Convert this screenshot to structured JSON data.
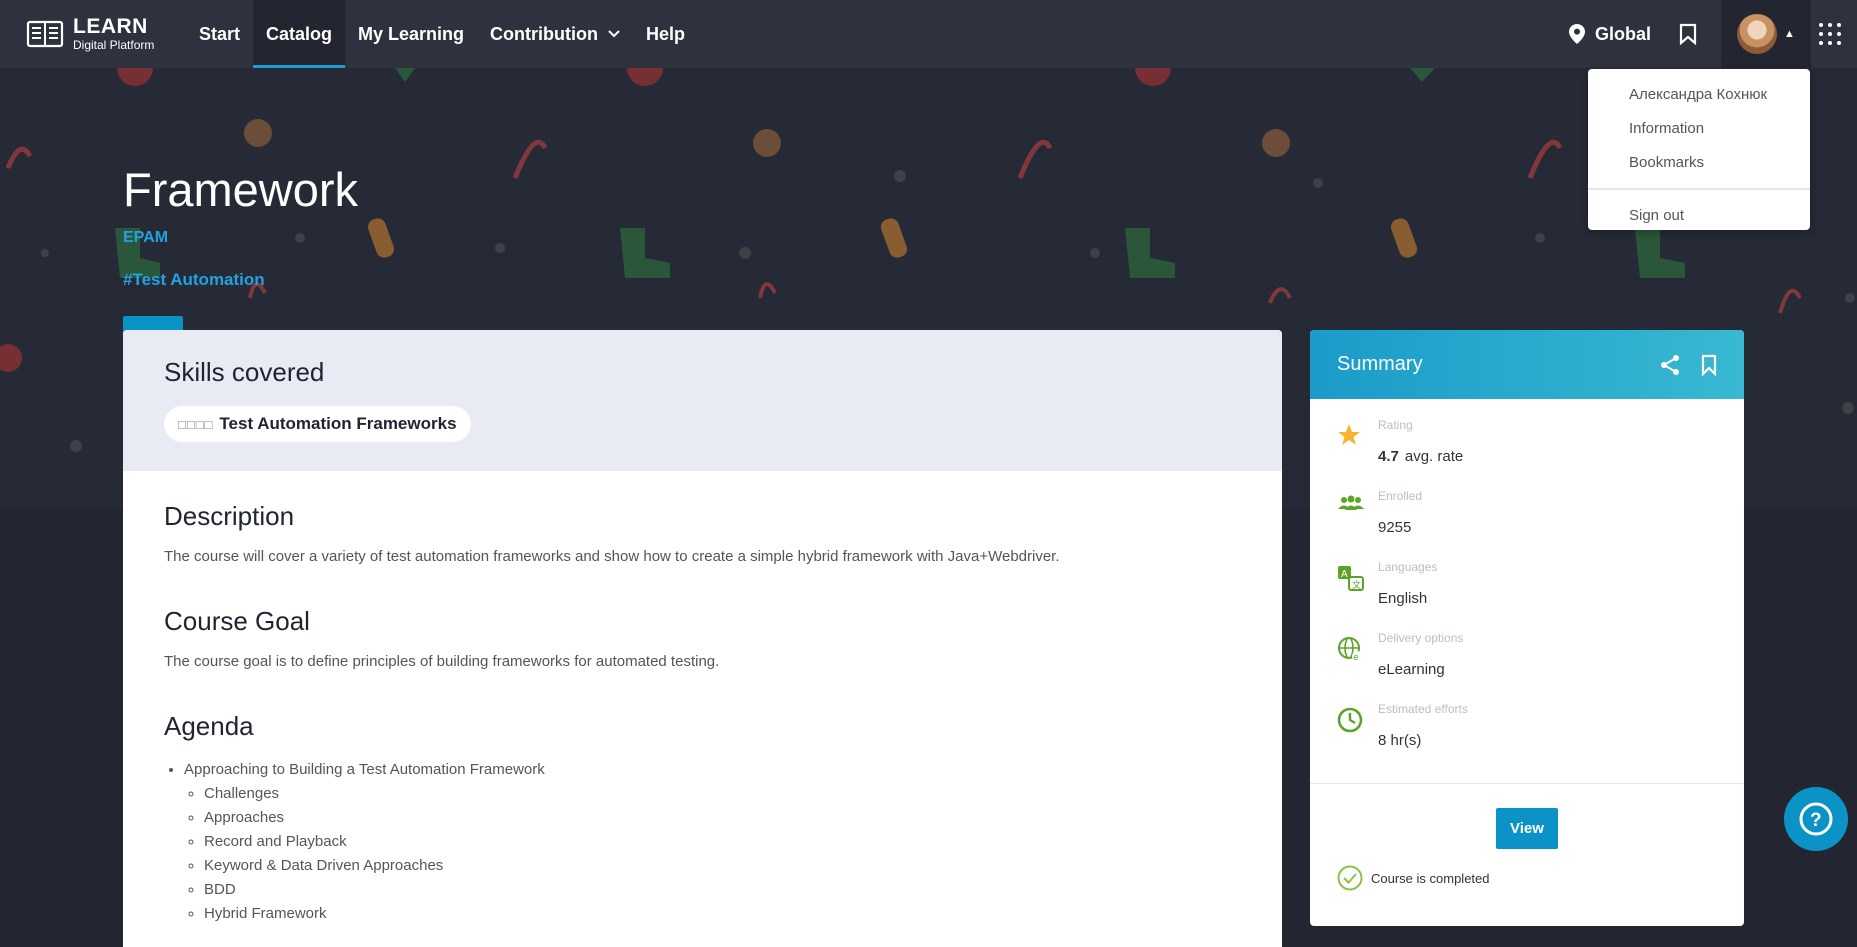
{
  "nav": {
    "logo_title": "LEARN",
    "logo_sub": "Digital Platform",
    "items": [
      {
        "label": "Start"
      },
      {
        "label": "Catalog"
      },
      {
        "label": "My Learning"
      },
      {
        "label": "Contribution"
      },
      {
        "label": "Help"
      }
    ],
    "global_label": "Global"
  },
  "dropdown": {
    "items": [
      {
        "label": "Александра Кохнюк"
      },
      {
        "label": "Information"
      },
      {
        "label": "Bookmarks"
      }
    ],
    "sign_out": "Sign out"
  },
  "hero": {
    "title": "Framework",
    "provider": "EPAM",
    "tag": "#Test Automation",
    "view_label": "View"
  },
  "skills": {
    "heading": "Skills covered",
    "chip_glyph": "□□□□",
    "chip_label": "Test Automation Frameworks"
  },
  "description": {
    "heading": "Description",
    "text": "The course will cover a variety of test automation frameworks and show how to create a simple hybrid framework with Java+Webdriver."
  },
  "goal": {
    "heading": "Course Goal",
    "text": "The course goal is to define principles of building frameworks for automated testing."
  },
  "agenda": {
    "heading": "Agenda",
    "item": "Approaching to Building a Test Automation Framework",
    "subitems": [
      "Challenges",
      "Approaches",
      "Record and Playback",
      "Keyword & Data Driven Approaches",
      "BDD",
      "Hybrid Framework"
    ]
  },
  "summary": {
    "title": "Summary",
    "rating_label": "Rating",
    "rating_value": "4.7",
    "rating_suffix": "avg. rate",
    "enrolled_label": "Enrolled",
    "enrolled_value": "9255",
    "languages_label": "Languages",
    "languages_value": "English",
    "delivery_label": "Delivery options",
    "delivery_value": "eLearning",
    "efforts_label": "Estimated efforts",
    "efforts_value": "8 hr(s)",
    "view_label": "View",
    "completed_label": "Course is completed"
  },
  "colors": {
    "accent": "#0b93c8",
    "topbar": "#2e313e",
    "hero": "#262a36",
    "icon_green": "#5da329",
    "star": "#f6b431"
  }
}
